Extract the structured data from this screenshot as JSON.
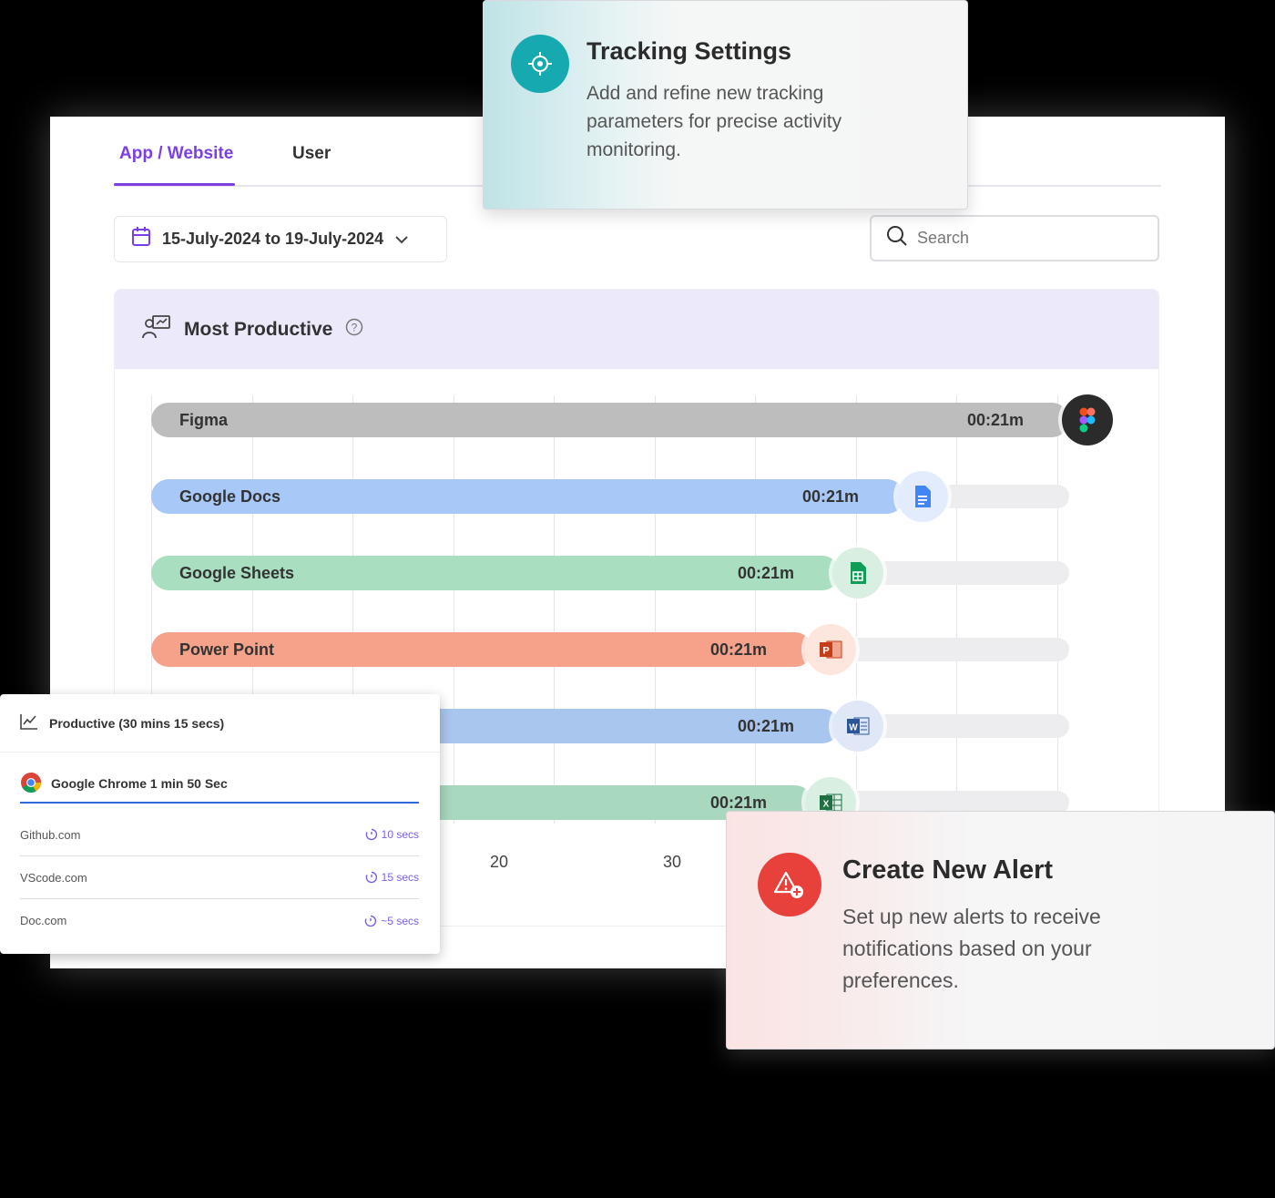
{
  "tabs": {
    "app_website": "App / Website",
    "user": "User"
  },
  "date_range": {
    "label": "15-July-2024 to 19-July-2024"
  },
  "search": {
    "placeholder": "Search"
  },
  "most_productive": {
    "title": "Most Productive"
  },
  "chart_data": {
    "type": "bar",
    "orientation": "horizontal",
    "categories": [
      "Figma",
      "Google Docs",
      "Google Sheets",
      "Power Point",
      "",
      ""
    ],
    "value_labels": [
      "00:21m",
      "00:21m",
      "00:21m",
      "00:21m",
      "00:21m",
      "00:21m"
    ],
    "fill_fractions": [
      1.0,
      0.82,
      0.75,
      0.72,
      0.75,
      0.72
    ],
    "colors": [
      "#bdbdbd",
      "#a8c8f8",
      "#a9dfc0",
      "#f6a28a",
      "#a9c6ef",
      "#a8d8be"
    ],
    "icons": [
      "figma-icon",
      "google-docs-icon",
      "google-sheets-icon",
      "powerpoint-icon",
      "word-icon",
      "excel-icon"
    ],
    "x_ticks": [
      "20",
      "30"
    ]
  },
  "tracking_settings": {
    "title": "Tracking Settings",
    "description": "Add and refine new tracking parameters for precise activity monitoring."
  },
  "activity_list": {
    "header": "Productive (30 mins 15 secs)",
    "top_app": "Google Chrome 1 min 50 Sec",
    "sites": [
      {
        "name": "Github.com",
        "duration": "10 secs"
      },
      {
        "name": "VScode.com",
        "duration": "15 secs"
      },
      {
        "name": "Doc.com",
        "duration": "~5 secs"
      }
    ]
  },
  "alert": {
    "title": "Create New Alert",
    "description": "Set up new alerts to receive notifications based on your preferences."
  }
}
